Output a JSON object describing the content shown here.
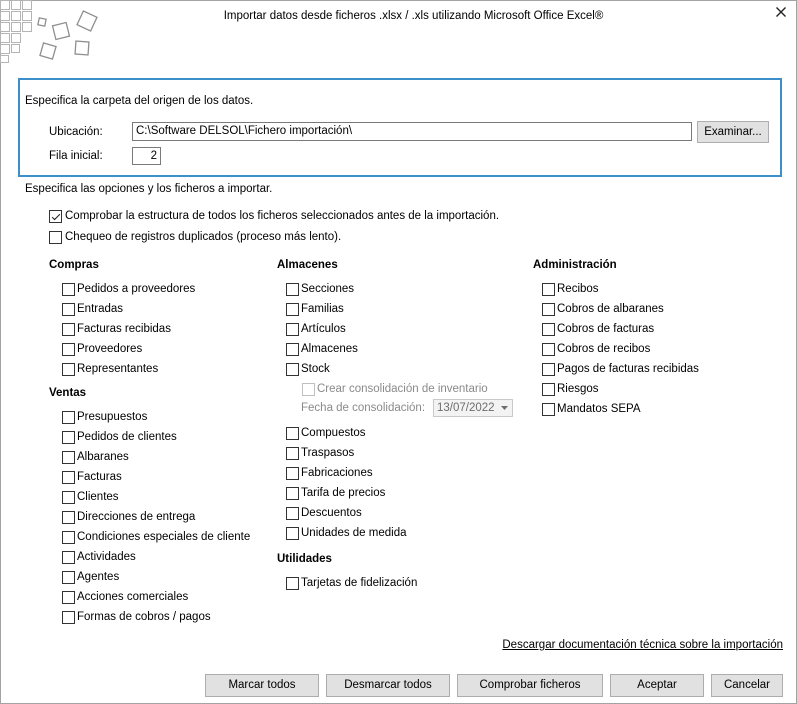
{
  "window": {
    "title": "Importar datos desde ficheros .xlsx / .xls utilizando Microsoft Office Excel®",
    "logo_icon": "import-logo-icon",
    "close_icon": "close-icon"
  },
  "source": {
    "heading": "Especifica la carpeta del origen de los datos.",
    "location_label": "Ubicación:",
    "location_value": "C:\\Software DELSOL\\Fichero importación\\",
    "browse_label": "Examinar...",
    "start_row_label": "Fila inicial:",
    "start_row_value": "2"
  },
  "options": {
    "heading": "Especifica las opciones y los ficheros a importar.",
    "check_structure": {
      "label": "Comprobar la estructura de todos los ficheros seleccionados antes de la importación.",
      "checked": true
    },
    "check_duplicates": {
      "label": "Chequeo de registros duplicados (proceso más lento).",
      "checked": false
    }
  },
  "compras": {
    "title": "Compras",
    "items": [
      {
        "label": "Pedidos a proveedores",
        "checked": false
      },
      {
        "label": "Entradas",
        "checked": false
      },
      {
        "label": "Facturas recibidas",
        "checked": false
      },
      {
        "label": "Proveedores",
        "checked": false
      },
      {
        "label": "Representantes",
        "checked": false
      }
    ]
  },
  "ventas": {
    "title": "Ventas",
    "items": [
      {
        "label": "Presupuestos",
        "checked": false
      },
      {
        "label": "Pedidos de clientes",
        "checked": false
      },
      {
        "label": "Albaranes",
        "checked": false
      },
      {
        "label": "Facturas",
        "checked": false
      },
      {
        "label": "Clientes",
        "checked": false
      },
      {
        "label": "Direcciones de entrega",
        "checked": false
      },
      {
        "label": "Condiciones especiales de cliente",
        "checked": false
      },
      {
        "label": "Actividades",
        "checked": false
      },
      {
        "label": "Agentes",
        "checked": false
      },
      {
        "label": "Acciones comerciales",
        "checked": false
      },
      {
        "label": "Formas de cobros / pagos",
        "checked": false
      }
    ]
  },
  "almacenes": {
    "title": "Almacenes",
    "items": [
      {
        "label": "Secciones",
        "checked": false
      },
      {
        "label": "Familias",
        "checked": false
      },
      {
        "label": "Artículos",
        "checked": false
      },
      {
        "label": "Almacenes",
        "checked": false
      },
      {
        "label": "Stock",
        "checked": false
      },
      {
        "label": "Compuestos",
        "checked": false
      },
      {
        "label": "Traspasos",
        "checked": false
      },
      {
        "label": "Fabricaciones",
        "checked": false
      },
      {
        "label": "Tarifa de precios",
        "checked": false
      },
      {
        "label": "Descuentos",
        "checked": false
      },
      {
        "label": "Unidades de medida",
        "checked": false
      }
    ]
  },
  "stock_options": {
    "consolidation_label": "Crear consolidación de inventario",
    "consolidation_checked": false,
    "consolidation_enabled": false,
    "date_label": "Fecha de consolidación:",
    "date_value": "13/07/2022"
  },
  "utilidades": {
    "title": "Utilidades",
    "items": [
      {
        "label": "Tarjetas de fidelización",
        "checked": false
      }
    ]
  },
  "administracion": {
    "title": "Administración",
    "items": [
      {
        "label": "Recibos",
        "checked": false
      },
      {
        "label": "Cobros de albaranes",
        "checked": false
      },
      {
        "label": "Cobros de facturas",
        "checked": false
      },
      {
        "label": "Cobros de recibos",
        "checked": false
      },
      {
        "label": "Pagos de facturas recibidas",
        "checked": false
      },
      {
        "label": "Riesgos",
        "checked": false
      },
      {
        "label": "Mandatos SEPA",
        "checked": false
      }
    ]
  },
  "link": {
    "label": "Descargar documentación técnica sobre la importación"
  },
  "buttons": {
    "mark_all": "Marcar todos",
    "unmark_all": "Desmarcar todos",
    "check_files": "Comprobar ficheros",
    "accept": "Aceptar",
    "cancel": "Cancelar"
  },
  "colors": {
    "accent": "#3d8fc9",
    "button_bg": "#e1e1e1",
    "disabled_text": "#8a8a8a"
  }
}
